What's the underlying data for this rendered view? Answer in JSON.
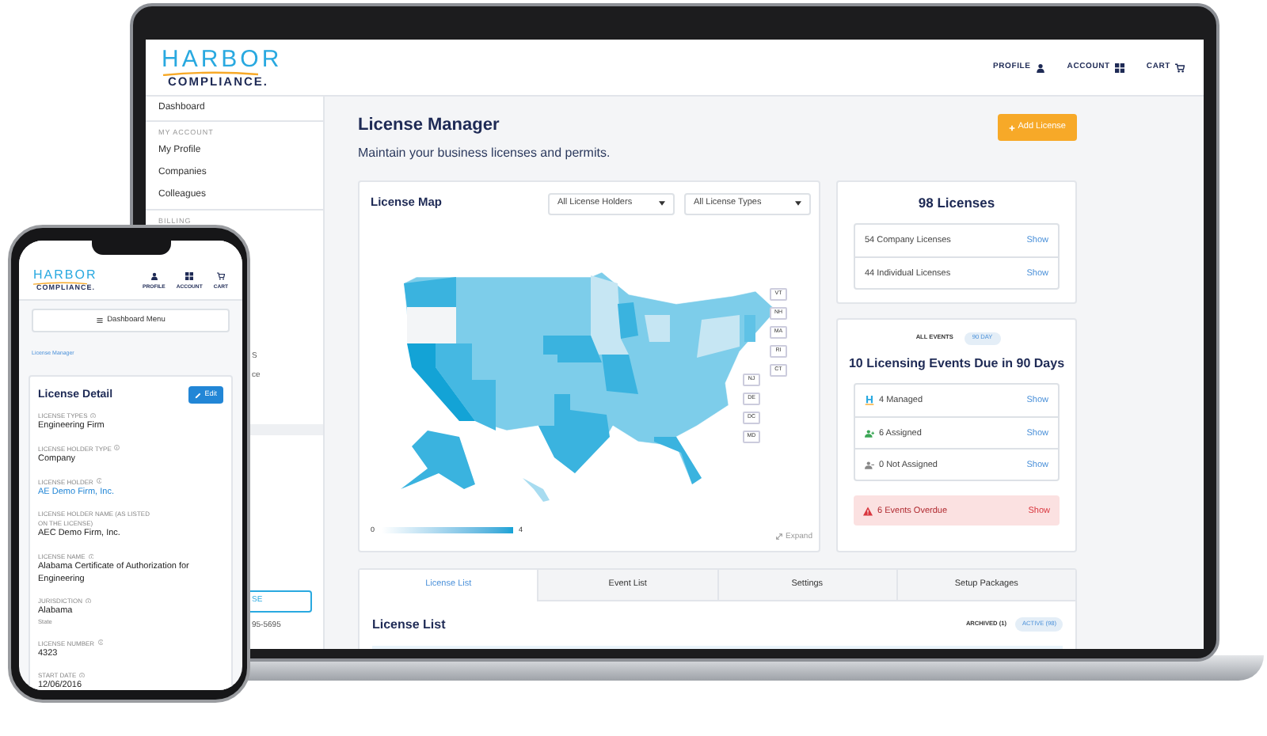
{
  "laptop": {
    "header": {
      "logo": {
        "top": "HARBOR",
        "bottom": "COMPLIANCE."
      },
      "nav": [
        {
          "label": "PROFILE"
        },
        {
          "label": "ACCOUNT"
        },
        {
          "label": "CART"
        }
      ]
    },
    "sidebar": {
      "items": [
        {
          "kind": "link",
          "label": "Dashboard"
        },
        {
          "kind": "heading",
          "label": "MY ACCOUNT"
        },
        {
          "kind": "link",
          "label": "My Profile"
        },
        {
          "kind": "link",
          "label": "Companies"
        },
        {
          "kind": "link",
          "label": "Colleagues"
        },
        {
          "kind": "heading",
          "label": "BILLING"
        }
      ],
      "fragments": [
        {
          "kind": "text",
          "label": "S"
        },
        {
          "kind": "text",
          "label": "ce"
        },
        {
          "kind": "button",
          "label": "SE"
        },
        {
          "kind": "text",
          "label": "95-5695"
        }
      ]
    },
    "main": {
      "title": "License Manager",
      "subtitle": "Maintain your business licenses and permits.",
      "add_button": "Add License",
      "map_card": {
        "title": "License Map",
        "filters": [
          "All License Holders",
          "All License Types"
        ],
        "state_labels": [
          "VT",
          "NH",
          "MA",
          "RI",
          "CT",
          "NJ",
          "DE",
          "DC",
          "MD"
        ],
        "legend": {
          "min": "0",
          "max": "4"
        },
        "expand": "Expand"
      },
      "licenses_card": {
        "title": "98 Licenses",
        "rows": [
          {
            "label": "54 Company Licenses",
            "action": "Show"
          },
          {
            "label": "44 Individual Licenses",
            "action": "Show"
          }
        ]
      },
      "events_card": {
        "toggle": [
          {
            "label": "ALL EVENTS",
            "selected": false
          },
          {
            "label": "90 DAY",
            "selected": true
          }
        ],
        "title": "10 Licensing Events Due in 90 Days",
        "rows": [
          {
            "kind": "managed",
            "label": "4 Managed",
            "action": "Show"
          },
          {
            "kind": "assigned",
            "label": "6 Assigned",
            "action": "Show"
          },
          {
            "kind": "unassigned",
            "label": "0 Not Assigned",
            "action": "Show"
          }
        ],
        "alert": {
          "label": "6 Events Overdue",
          "action": "Show"
        }
      },
      "tabs": [
        {
          "label": "License List",
          "selected": true
        },
        {
          "label": "Event List",
          "selected": false
        },
        {
          "label": "Settings",
          "selected": false
        },
        {
          "label": "Setup Packages",
          "selected": false
        }
      ],
      "list": {
        "title": "License List",
        "filters": [
          {
            "label": "ARCHIVED (1)",
            "selected": false
          },
          {
            "label": "ACTIVE (98)",
            "selected": true
          }
        ]
      }
    }
  },
  "phone": {
    "header": {
      "logo": {
        "top": "HARBOR",
        "bottom": "COMPLIANCE."
      },
      "nav": [
        {
          "label": "PROFILE"
        },
        {
          "label": "ACCOUNT"
        },
        {
          "label": "CART"
        }
      ]
    },
    "menu_button": "Dashboard Menu",
    "breadcrumb": "License Manager",
    "detail": {
      "title": "License Detail",
      "edit_button": "Edit",
      "fields": [
        {
          "label": "LICENSE TYPES",
          "info": true,
          "value": "Engineering Firm",
          "link": false
        },
        {
          "label": "LICENSE HOLDER TYPE",
          "info": true,
          "value": "Company",
          "link": false
        },
        {
          "label": "LICENSE HOLDER",
          "info": true,
          "value": "AE Demo Firm, Inc.",
          "link": true
        },
        {
          "label": "LICENSE HOLDER NAME (AS LISTED ON THE LICENSE)",
          "info": false,
          "value": "AEC Demo Firm, Inc.",
          "link": false
        },
        {
          "label": "LICENSE NAME",
          "info": true,
          "value": "Alabama Certificate of Authorization for Engineering",
          "link": false
        },
        {
          "label": "JURISDICTION",
          "info": true,
          "value": "Alabama",
          "note": "State",
          "link": false
        },
        {
          "label": "LICENSE NUMBER",
          "info": true,
          "value": "4323",
          "link": false
        },
        {
          "label": "START DATE",
          "info": true,
          "value": "12/06/2016",
          "link": false
        }
      ]
    }
  }
}
